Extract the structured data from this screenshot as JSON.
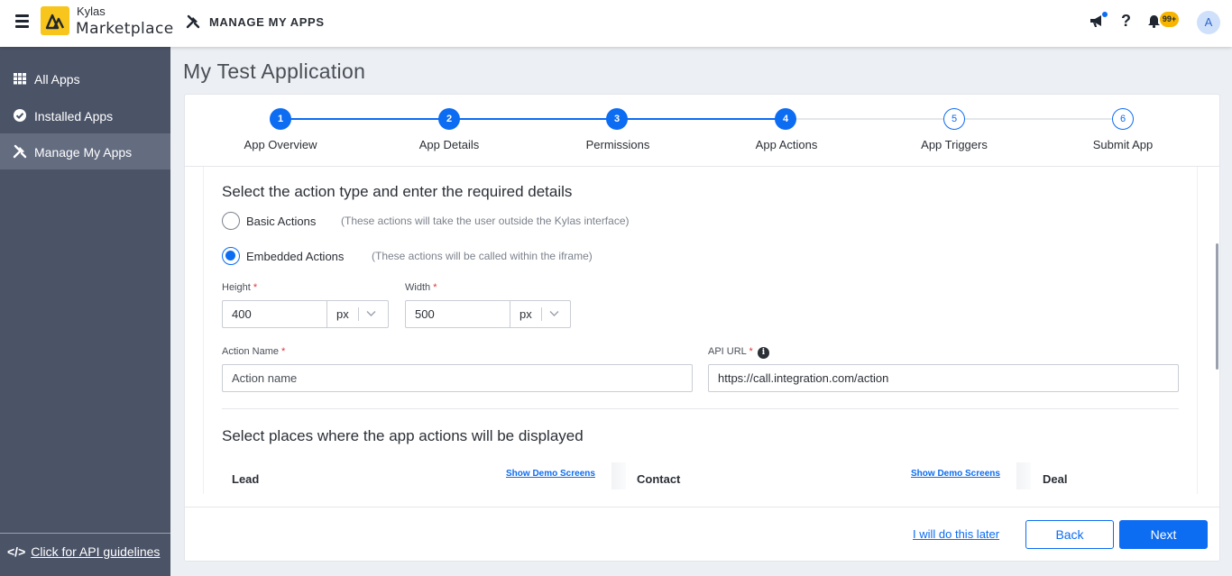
{
  "header": {
    "brand_small": "Kylas",
    "brand_big": "Marketplace",
    "page_title": "MANAGE MY APPS",
    "help_label": "?",
    "notification_count": "99+",
    "avatar_initial": "A"
  },
  "sidebar": {
    "items": [
      {
        "label": "All Apps",
        "icon": "grid-icon"
      },
      {
        "label": "Installed Apps",
        "icon": "check-circle-icon"
      },
      {
        "label": "Manage My Apps",
        "icon": "tools-icon",
        "active": true
      }
    ],
    "api_link": "Click for API guidelines"
  },
  "main": {
    "app_title": "My Test Application",
    "steps": [
      {
        "number": "1",
        "label": "App Overview",
        "done": true
      },
      {
        "number": "2",
        "label": "App Details",
        "done": true
      },
      {
        "number": "3",
        "label": "Permissions",
        "done": true
      },
      {
        "number": "4",
        "label": "App Actions",
        "done": true
      },
      {
        "number": "5",
        "label": "App Triggers",
        "done": false
      },
      {
        "number": "6",
        "label": "Submit App",
        "done": false
      }
    ],
    "action_section_title": "Select the action type and enter the required details",
    "basic_actions": {
      "label": "Basic Actions",
      "hint": "(These actions will take the user outside the Kylas interface)",
      "checked": false
    },
    "embedded_actions": {
      "label": "Embedded Actions",
      "hint": "(These actions will be called within the iframe)",
      "checked": true
    },
    "height": {
      "label": "Height",
      "required": "*",
      "value": "400",
      "unit": "px"
    },
    "width": {
      "label": "Width",
      "required": "*",
      "value": "500",
      "unit": "px"
    },
    "action_name": {
      "label": "Action Name",
      "required": "*",
      "placeholder": "Action name"
    },
    "api_url": {
      "label": "API URL",
      "required": "*",
      "value": "https://call.integration.com/action",
      "info_glyph": "i"
    },
    "places_section_title": "Select places where the app actions will be displayed",
    "entities": [
      {
        "name": "Lead",
        "demo_link": "Show Demo Screens"
      },
      {
        "name": "Contact",
        "demo_link": "Show Demo Screens"
      },
      {
        "name": "Deal"
      }
    ]
  },
  "footer": {
    "later_link": "I will do this later",
    "back_label": "Back",
    "next_label": "Next"
  },
  "colors": {
    "accent": "#0c6cf2",
    "sidebar_bg": "#4b5367",
    "sidebar_active": "#646c80",
    "badge": "#f7b500",
    "logo": "#f7c51b"
  }
}
